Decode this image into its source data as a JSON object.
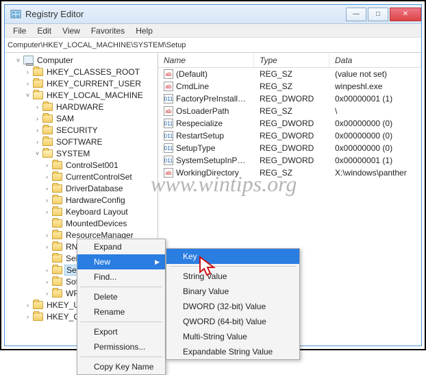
{
  "window": {
    "title": "Registry Editor"
  },
  "menubar": [
    "File",
    "Edit",
    "View",
    "Favorites",
    "Help"
  ],
  "address": "Computer\\HKEY_LOCAL_MACHINE\\SYSTEM\\Setup",
  "tree": {
    "root": "Computer",
    "hives": [
      "HKEY_CLASSES_ROOT",
      "HKEY_CURRENT_USER",
      "HKEY_LOCAL_MACHINE",
      "HKEY_USE…",
      "HKEY_CUR…"
    ],
    "hklm": [
      "HARDWARE",
      "SAM",
      "SECURITY",
      "SOFTWARE",
      "SYSTEM"
    ],
    "system": [
      "ControlSet001",
      "CurrentControlSet",
      "DriverDatabase",
      "HardwareConfig",
      "Keyboard Layout",
      "MountedDevices",
      "ResourceManager",
      "RNG",
      "Select",
      "Setup",
      "Softw…",
      "WPA"
    ]
  },
  "columns": {
    "name": "Name",
    "type": "Type",
    "data": "Data"
  },
  "values": [
    {
      "icon": "sz",
      "name": "(Default)",
      "type": "REG_SZ",
      "data": "(value not set)"
    },
    {
      "icon": "sz",
      "name": "CmdLine",
      "type": "REG_SZ",
      "data": "winpeshl.exe"
    },
    {
      "icon": "dw",
      "name": "FactoryPreInstall…",
      "type": "REG_DWORD",
      "data": "0x00000001 (1)"
    },
    {
      "icon": "sz",
      "name": "OsLoaderPath",
      "type": "REG_SZ",
      "data": "\\"
    },
    {
      "icon": "dw",
      "name": "Respecialize",
      "type": "REG_DWORD",
      "data": "0x00000000 (0)"
    },
    {
      "icon": "dw",
      "name": "RestartSetup",
      "type": "REG_DWORD",
      "data": "0x00000000 (0)"
    },
    {
      "icon": "dw",
      "name": "SetupType",
      "type": "REG_DWORD",
      "data": "0x00000000 (0)"
    },
    {
      "icon": "dw",
      "name": "SystemSetupInP…",
      "type": "REG_DWORD",
      "data": "0x00000001 (1)"
    },
    {
      "icon": "sz",
      "name": "WorkingDirectory",
      "type": "REG_SZ",
      "data": "X:\\windows\\panther"
    }
  ],
  "ctx1": {
    "items": [
      "Expand",
      "New",
      "Find...",
      "Delete",
      "Rename",
      "Export",
      "Permissions...",
      "Copy Key Name"
    ],
    "highlighted": "New"
  },
  "ctx2": {
    "items": [
      "Key",
      "String Value",
      "Binary Value",
      "DWORD (32-bit) Value",
      "QWORD (64-bit) Value",
      "Multi-String Value",
      "Expandable String Value"
    ],
    "highlighted": "Key"
  },
  "watermark": "www.wintips.org"
}
